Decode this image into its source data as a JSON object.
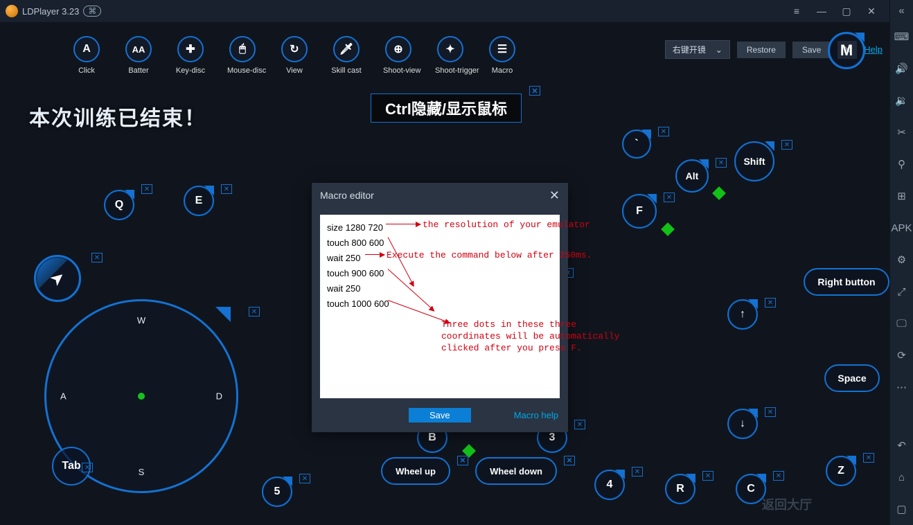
{
  "app": {
    "title": "LDPlayer 3.23"
  },
  "toolbar": {
    "items": [
      {
        "glyph": "A",
        "label": "Click"
      },
      {
        "glyph": "AA",
        "label": "Batter"
      },
      {
        "glyph": "✚",
        "label": "Key-disc"
      },
      {
        "glyph": "🖱",
        "label": "Mouse-disc"
      },
      {
        "glyph": "↻",
        "label": "View"
      },
      {
        "glyph": "🗡",
        "label": "Skill cast"
      },
      {
        "glyph": "⊕",
        "label": "Shoot-view"
      },
      {
        "glyph": "✦",
        "label": "Shoot-trigger"
      },
      {
        "glyph": "☰",
        "label": "Macro"
      }
    ]
  },
  "topright": {
    "dropdown": "右键开镜",
    "restore": "Restore",
    "save": "Save",
    "help": "Help"
  },
  "banner": "Ctrl隐藏/显示鼠标",
  "overlay_text": "本次训练已结束！",
  "dpad": {
    "up": "W",
    "left": "A",
    "right": "D",
    "down": "S",
    "tab": "Tab"
  },
  "keys": {
    "M": "M",
    "Q": "Q",
    "E": "E",
    "tilde": "`",
    "Alt": "Alt",
    "Shift": "Shift",
    "F": "F",
    "B": "B",
    "num3": "3",
    "num4": "4",
    "num5": "5",
    "R": "R",
    "C": "C",
    "Z": "Z",
    "WheelUp": "Wheel up",
    "WheelDown": "Wheel down",
    "up": "↑",
    "down": "↓",
    "Space": "Space",
    "RightButton": "Right button"
  },
  "macro": {
    "title": "Macro editor",
    "lines": [
      "size 1280 720",
      "touch 800 600",
      "wait 250",
      "touch 900 600",
      "wait 250",
      "touch 1000 600"
    ],
    "save": "Save",
    "help": "Macro help",
    "ann1": "the resolution of your emulator",
    "ann2": "Execute the command below after 250ms.",
    "ann3": "Three dots in these three\ncoordinates will be automatically\nclicked after you press F."
  },
  "return_hall": "返回大厅"
}
